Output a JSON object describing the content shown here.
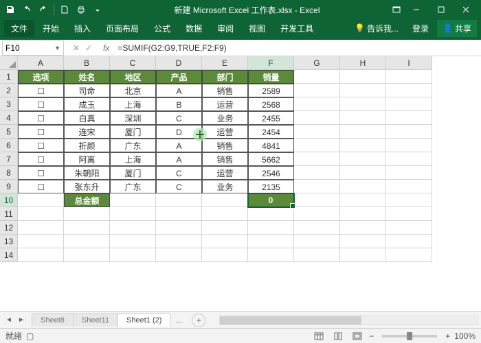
{
  "title": "新建 Microsoft Excel 工作表.xlsx - Excel",
  "menu": {
    "file": "文件",
    "home": "开始",
    "insert": "插入",
    "layout": "页面布局",
    "formula": "公式",
    "data": "数据",
    "review": "审阅",
    "view": "视图",
    "dev": "开发工具",
    "tellme": "告诉我...",
    "signin": "登录",
    "share": "共享"
  },
  "namebox": "F10",
  "formula": "=SUMIF(G2:G9,TRUE,F2:F9)",
  "cols": [
    "A",
    "B",
    "C",
    "D",
    "E",
    "F",
    "G",
    "H",
    "I"
  ],
  "rows": [
    "1",
    "2",
    "3",
    "4",
    "5",
    "6",
    "7",
    "8",
    "9",
    "10",
    "11",
    "12",
    "13",
    "14"
  ],
  "headers": {
    "A": "选项",
    "B": "姓名",
    "C": "地区",
    "D": "产品",
    "E": "部门",
    "F": "销量"
  },
  "data": [
    {
      "a": "☐",
      "b": "司命",
      "c": "北京",
      "d": "A",
      "e": "销售",
      "f": "2589"
    },
    {
      "a": "☐",
      "b": "成玉",
      "c": "上海",
      "d": "B",
      "e": "运营",
      "f": "2568"
    },
    {
      "a": "☐",
      "b": "白真",
      "c": "深圳",
      "d": "C",
      "e": "业务",
      "f": "2455"
    },
    {
      "a": "☐",
      "b": "连宋",
      "c": "厦门",
      "d": "D",
      "e": "运营",
      "f": "2454"
    },
    {
      "a": "☐",
      "b": "折颜",
      "c": "广东",
      "d": "A",
      "e": "销售",
      "f": "4841"
    },
    {
      "a": "☐",
      "b": "阿离",
      "c": "上海",
      "d": "A",
      "e": "销售",
      "f": "5662"
    },
    {
      "a": "☐",
      "b": "朱朝阳",
      "c": "厦门",
      "d": "C",
      "e": "运营",
      "f": "2546"
    },
    {
      "a": "☐",
      "b": "张东升",
      "c": "广东",
      "d": "C",
      "e": "业务",
      "f": "2135"
    }
  ],
  "total_label": "总金额",
  "total_value": "0",
  "tabs": [
    "Sheet8",
    "Sheet11",
    "Sheet1 (2)"
  ],
  "tab_more": "...",
  "status": {
    "ready": "就绪",
    "zoom": "100%"
  },
  "chart_data": {
    "type": "table",
    "columns": [
      "选项",
      "姓名",
      "地区",
      "产品",
      "部门",
      "销量"
    ],
    "rows": [
      [
        "☐",
        "司命",
        "北京",
        "A",
        "销售",
        2589
      ],
      [
        "☐",
        "成玉",
        "上海",
        "B",
        "运营",
        2568
      ],
      [
        "☐",
        "白真",
        "深圳",
        "C",
        "业务",
        2455
      ],
      [
        "☐",
        "连宋",
        "厦门",
        "D",
        "运营",
        2454
      ],
      [
        "☐",
        "折颜",
        "广东",
        "A",
        "销售",
        4841
      ],
      [
        "☐",
        "阿离",
        "上海",
        "A",
        "销售",
        5662
      ],
      [
        "☐",
        "朱朝阳",
        "厦门",
        "C",
        "运营",
        2546
      ],
      [
        "☐",
        "张东升",
        "广东",
        "C",
        "业务",
        2135
      ]
    ],
    "summary": {
      "label": "总金额",
      "value": 0
    }
  }
}
